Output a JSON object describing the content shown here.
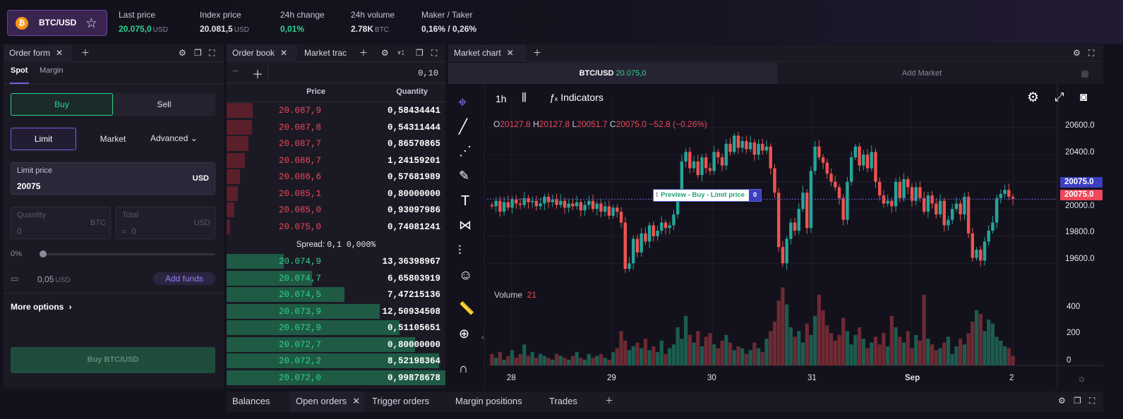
{
  "header": {
    "pair": "BTC/USD",
    "coin_letter": "₿",
    "stats": [
      {
        "label": "Last price",
        "value": "20.075,0",
        "unit": "USD",
        "color": "green"
      },
      {
        "label": "Index price",
        "value": "20.081,5",
        "unit": "USD",
        "color": "white"
      },
      {
        "label": "24h change",
        "value": "0,01%",
        "unit": "",
        "color": "green"
      },
      {
        "label": "24h volume",
        "value": "2.78K",
        "unit": "BTC",
        "color": "white"
      },
      {
        "label": "Maker / Taker",
        "value": "0,16% / 0,26%",
        "unit": "",
        "color": "white"
      }
    ]
  },
  "order_form": {
    "tab": "Order form",
    "subtabs": [
      "Spot",
      "Margin"
    ],
    "buy": "Buy",
    "sell": "Sell",
    "types": [
      "Limit",
      "Market",
      "Advanced"
    ],
    "limit_label": "Limit price",
    "limit_value": "20075",
    "limit_unit": "USD",
    "qty_label": "Quantity",
    "qty_value": "0",
    "qty_unit": "BTC",
    "total_label": "Total",
    "total_prefix": "≈",
    "total_value": "0",
    "total_unit": "USD",
    "slider_pct": "0%",
    "balance": "0,05",
    "balance_unit": "USD",
    "add_funds": "Add funds",
    "more_options": "More options",
    "submit": "Buy BTC/USD"
  },
  "order_book": {
    "tabs": [
      "Order book",
      "Market trac"
    ],
    "depth_badge": "1",
    "increment": "0,10",
    "col_price": "Price",
    "col_qty": "Quantity",
    "asks": [
      {
        "price": "20.087,9",
        "qty": "0,58434441",
        "depth": 0.12
      },
      {
        "price": "20.087,8",
        "qty": "0,54311444",
        "depth": 0.115
      },
      {
        "price": "20.087,7",
        "qty": "0,86570865",
        "depth": 0.1
      },
      {
        "price": "20.086,7",
        "qty": "1,24159201",
        "depth": 0.085
      },
      {
        "price": "20.086,6",
        "qty": "0,57681989",
        "depth": 0.06
      },
      {
        "price": "20.085,1",
        "qty": "0,80000000",
        "depth": 0.05
      },
      {
        "price": "20.085,0",
        "qty": "0,93097986",
        "depth": 0.035
      },
      {
        "price": "20.075,0",
        "qty": "0,74081241",
        "depth": 0.015
      }
    ],
    "spread_label": "Spread:",
    "spread_value": "0,1 0,000%",
    "bids": [
      {
        "price": "20.074,9",
        "qty": "13,36398967",
        "depth": 0.26
      },
      {
        "price": "20.074,7",
        "qty": "6,65803919",
        "depth": 0.39
      },
      {
        "price": "20.074,5",
        "qty": "7,47215136",
        "depth": 0.54
      },
      {
        "price": "20.073,9",
        "qty": "12,50934508",
        "depth": 0.7
      },
      {
        "price": "20.072,9",
        "qty": "0,51105651",
        "depth": 0.79
      },
      {
        "price": "20.072,7",
        "qty": "0,80000000",
        "depth": 0.86
      },
      {
        "price": "20.072,2",
        "qty": "8,52198364",
        "depth": 0.97
      },
      {
        "price": "20.072,0",
        "qty": "0,99878678",
        "depth": 1.0
      }
    ]
  },
  "chart_panel": {
    "tab": "Market chart",
    "market_tab_pair": "BTC/USD",
    "market_tab_price": "20.075,0",
    "add_market": "Add Market",
    "interval": "1h",
    "indicators": "Indicators",
    "ohlc": {
      "o": "20127.8",
      "h": "20127.8",
      "l": "20051.7",
      "c": "20075.0",
      "chg": "−52.8 (−0.26%)"
    },
    "preview_label": "Preview - Buy - Limit price",
    "preview_qty": "0",
    "volume_label": "Volume",
    "volume_value": "21",
    "price_ticks": [
      "20600.0",
      "20400.0",
      "20000.0",
      "19800.0",
      "19600.0"
    ],
    "tag_blue": "20075.0",
    "tag_red": "20075.0",
    "vol_ticks": [
      "400",
      "200",
      "0"
    ],
    "x_ticks": [
      "28",
      "29",
      "30",
      "31",
      "Sep",
      "2"
    ]
  },
  "chart_data": {
    "type": "candlestick",
    "ylim": [
      19500,
      20700
    ],
    "volume_ylim": [
      0,
      500
    ],
    "last_price": 20075.0,
    "x_labels": [
      "28",
      "29",
      "30",
      "31",
      "Sep",
      "2"
    ],
    "close": [
      20020,
      20060,
      19980,
      20050,
      20010,
      20070,
      20040,
      20030,
      20080,
      20050,
      20060,
      20020,
      20040,
      20090,
      20050,
      20070,
      20030,
      20060,
      20010,
      20040,
      20020,
      20050,
      19990,
      20030,
      20060,
      20000,
      20040,
      19980,
      20020,
      19950,
      20010,
      19980,
      19900,
      19560,
      19600,
      19780,
      19680,
      19820,
      19760,
      19880,
      19800,
      19840,
      19900,
      19860,
      19880,
      19960,
      20100,
      20350,
      20420,
      20300,
      20350,
      20250,
      20380,
      20300,
      20280,
      20420,
      20380,
      20320,
      20480,
      20420,
      20540,
      20450,
      20500,
      20440,
      20490,
      20400,
      20480,
      20430,
      20460,
      20300,
      20120,
      19720,
      19600,
      19780,
      19900,
      19840,
      20000,
      20120,
      19860,
      20280,
      20460,
      20380,
      20340,
      20260,
      20200,
      20160,
      20080,
      19920,
      20200,
      20380,
      20460,
      20320,
      20400,
      20300,
      20420,
      20200,
      20100,
      20040,
      20060,
      20020,
      20200,
      20080,
      20220,
      20160,
      20060,
      20160,
      20080,
      19980,
      20100,
      20040,
      19960,
      20060,
      19880,
      19920,
      20000,
      20040,
      19960,
      20090,
      19820,
      19640,
      19700,
      19620,
      19760,
      19840,
      19900,
      20080,
      20110,
      20140,
      20090,
      20075
    ],
    "volume": [
      60,
      40,
      70,
      30,
      50,
      80,
      40,
      60,
      110,
      50,
      70,
      40,
      60,
      50,
      40,
      30,
      60,
      50,
      40,
      30,
      50,
      70,
      40,
      30,
      60,
      40,
      50,
      60,
      40,
      30,
      70,
      90,
      180,
      130,
      80,
      100,
      120,
      90,
      140,
      80,
      100,
      70,
      130,
      60,
      90,
      110,
      200,
      140,
      260,
      160,
      120,
      180,
      100,
      150,
      170,
      110,
      90,
      130,
      160,
      120,
      80,
      100,
      90,
      60,
      80,
      120,
      90,
      70,
      140,
      180,
      230,
      340,
      410,
      320,
      200,
      150,
      180,
      120,
      220,
      160,
      260,
      370,
      290,
      210,
      170,
      130,
      160,
      250,
      180,
      110,
      160,
      200,
      140,
      90,
      120,
      150,
      110,
      170,
      100,
      260,
      200,
      150,
      120,
      180,
      90,
      160,
      130,
      370,
      140,
      110,
      80,
      90,
      120,
      150,
      60,
      100,
      140,
      110,
      170,
      230,
      290,
      270,
      180,
      240,
      220,
      150,
      130,
      100,
      90,
      50
    ]
  },
  "bottom_tabs": [
    "Balances",
    "Open orders",
    "Trigger orders",
    "Margin positions",
    "Trades"
  ],
  "colors": {
    "green": "#2ed58f",
    "red": "#f0475a",
    "accent": "#7b5ce0",
    "up_candle": "#26a69a",
    "down_candle": "#ef5350"
  }
}
